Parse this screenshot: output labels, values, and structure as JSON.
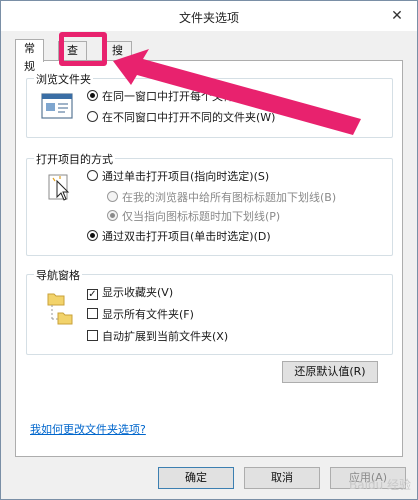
{
  "window": {
    "title": "文件夹选项",
    "close_glyph": "✕"
  },
  "tabs": [
    {
      "label": "常规",
      "active": true
    },
    {
      "label": "查看",
      "active": false
    },
    {
      "label": "搜索",
      "active": false
    }
  ],
  "browse": {
    "title": "浏览文件夹",
    "options": [
      {
        "label": "在同一窗口中打开每个文件夹(M)",
        "selected": true
      },
      {
        "label": "在不同窗口中打开不同的文件夹(W)",
        "selected": false
      }
    ]
  },
  "click": {
    "title": "打开项目的方式",
    "single": {
      "label": "通过单击打开项目(指向时选定)(S)",
      "selected": false
    },
    "sub_options": [
      {
        "label": "在我的浏览器中给所有图标标题加下划线(B)",
        "selected": false,
        "disabled": true
      },
      {
        "label": "仅当指向图标标题时加下划线(P)",
        "selected": true,
        "disabled": true
      }
    ],
    "double": {
      "label": "通过双击打开项目(单击时选定)(D)",
      "selected": true
    }
  },
  "nav": {
    "title": "导航窗格",
    "options": [
      {
        "label": "显示收藏夹(V)",
        "checked": true
      },
      {
        "label": "显示所有文件夹(F)",
        "checked": false
      },
      {
        "label": "自动扩展到当前文件夹(X)",
        "checked": false
      }
    ]
  },
  "restore_button": "还原默认值(R)",
  "help_link": "我如何更改文件夹选项?",
  "footer": {
    "ok": "确定",
    "cancel": "取消",
    "apply": "应用(A)"
  },
  "icons": {
    "close": "close-icon",
    "browse_illustration": "window-illustration-icon",
    "click_illustration": "cursor-click-icon",
    "nav_illustration": "folder-tree-icon"
  },
  "annotation": {
    "color": "#e8226e"
  },
  "watermark": "Baidu 经验"
}
